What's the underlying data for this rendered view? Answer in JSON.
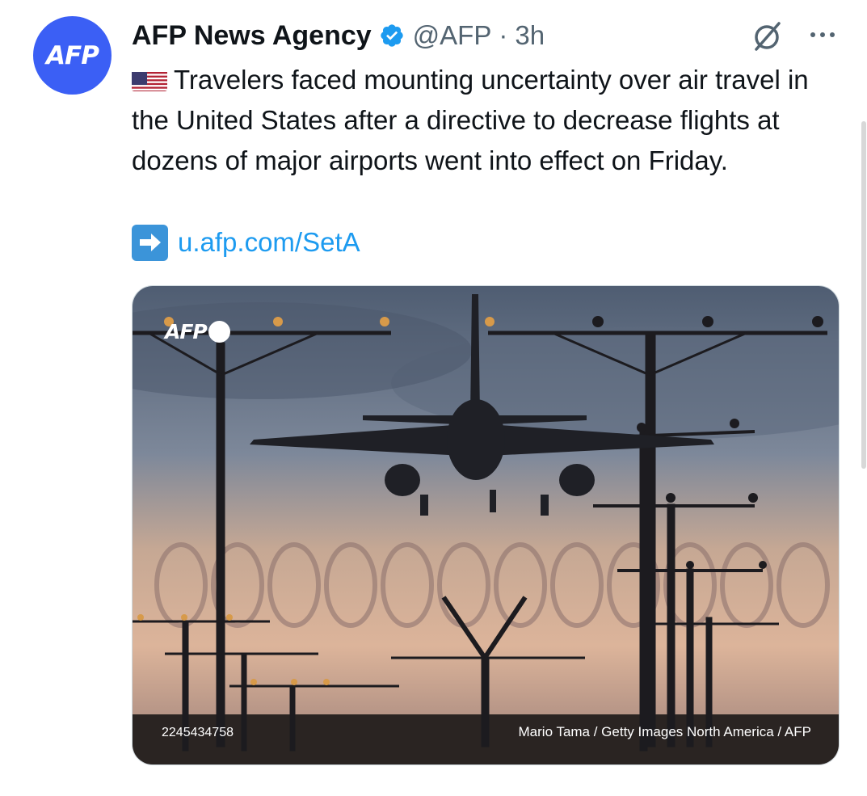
{
  "tweet": {
    "avatar_text": "AFP",
    "author_name": "AFP News Agency",
    "handle": "@AFP",
    "separator": "·",
    "time": "3h",
    "flag_icon": "us-flag-icon",
    "text": "Travelers faced mounting uncertainty over air travel in the United States after a directive to decrease flights at dozens of major airports went into effect on Friday.",
    "link_icon": "right-arrow-icon",
    "link": "u.afp.com/SetA",
    "media": {
      "watermark": "AFP",
      "photo_id": "2245434758",
      "credit": "Mario Tama / Getty Images North America / AFP"
    }
  },
  "colors": {
    "avatar_bg": "#3b5ff5",
    "verified": "#1d9bf0",
    "link": "#1d9bf0",
    "muted_text": "#536471"
  }
}
